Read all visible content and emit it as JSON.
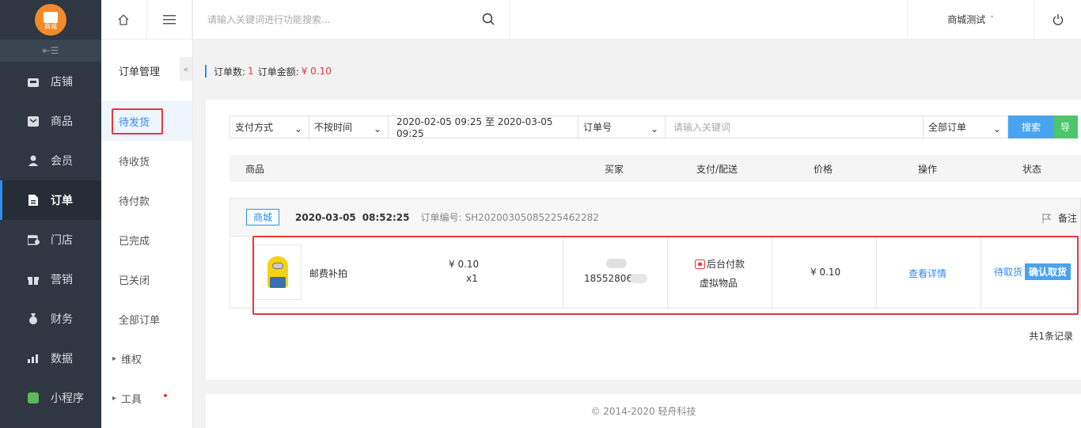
{
  "brand": {
    "logo_text": "商城",
    "color": "#f28a2a"
  },
  "sidebar": {
    "items": [
      {
        "label": "店铺",
        "icon": "store-icon"
      },
      {
        "label": "商品",
        "icon": "goods-icon"
      },
      {
        "label": "会员",
        "icon": "member-icon"
      },
      {
        "label": "订单",
        "icon": "order-icon",
        "active": true
      },
      {
        "label": "门店",
        "icon": "shop-icon"
      },
      {
        "label": "营销",
        "icon": "gift-icon"
      },
      {
        "label": "财务",
        "icon": "finance-icon"
      },
      {
        "label": "数据",
        "icon": "chart-icon"
      },
      {
        "label": "小程序",
        "icon": "miniapp-icon"
      }
    ]
  },
  "submenu": {
    "title": "订单管理",
    "items": [
      "待发货",
      "待收货",
      "待付款",
      "已完成",
      "已关闭",
      "全部订单"
    ],
    "groups": [
      "维权",
      "工具"
    ]
  },
  "topbar": {
    "search_placeholder": "请输入关键词进行功能搜索...",
    "store_name": "商城测试"
  },
  "summary": {
    "count_label": "订单数:",
    "count": "1",
    "amount_label": "订单金额:",
    "amount": "¥ 0.10"
  },
  "filters": {
    "pay_method": "支付方式",
    "time_type": "不按时间",
    "date_range": "2020-02-05 09:25 至 2020-03-05 09:25",
    "field": "订单号",
    "keyword_placeholder": "请输入关键词",
    "order_type": "全部订单",
    "search_btn": "搜索",
    "export_btn": "导"
  },
  "table": {
    "headers": [
      "商品",
      "买家",
      "支付/配送",
      "价格",
      "操作",
      "状态"
    ]
  },
  "order": {
    "shop_tag": "商城",
    "date": "2020-03-05",
    "time": "08:52:25",
    "order_no_label": "订单编号:",
    "order_no": "SH20200305085225462282",
    "remark": "备注",
    "product_name": "邮费补拍",
    "unit_price": "¥ 0.10",
    "qty": "x1",
    "buyer_phone": "18552806",
    "pay_type": "后台付款",
    "delivery": "虚拟物品",
    "price": "¥ 0.10",
    "action": "查看详情",
    "status": "待取货",
    "confirm_btn": "确认取货"
  },
  "pager": {
    "total": "共1条记录"
  },
  "footer": {
    "copyright": "© 2014-2020 轻舟科技"
  },
  "colors": {
    "accent": "#2d8cf0",
    "danger": "#e4393c",
    "success": "#4cc56b"
  }
}
